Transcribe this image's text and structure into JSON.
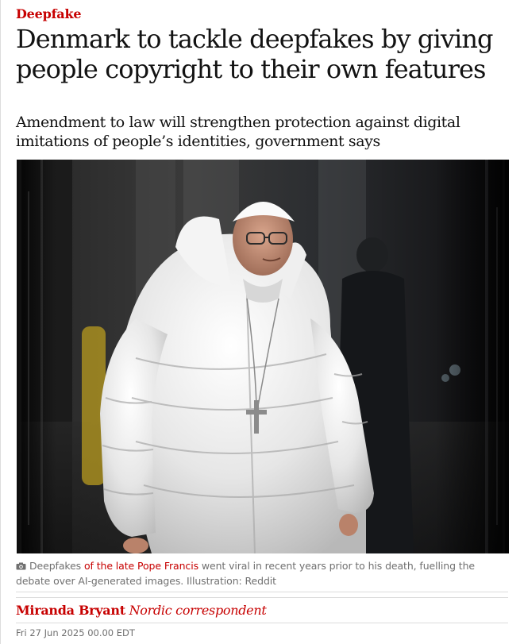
{
  "article": {
    "kicker": "Deepfake",
    "headline": "Denmark to tackle deepfakes by giving people copyright to their own features",
    "standfirst": "Amendment to law will strengthen protection against digital imitations of people’s identities, government says"
  },
  "caption": {
    "camera_icon": "camera-icon",
    "lead": "Deepfakes ",
    "link_text": "of the late Pope Francis",
    "rest": " went viral in recent years prior to his death, fuelling the debate over AI-generated images. Illustration: Reddit"
  },
  "byline": {
    "name": "Miranda Bryant",
    "role": "Nordic correspondent"
  },
  "dateline": "Fri 27 Jun 2025 00.00 EDT",
  "colors": {
    "accent_red": "#c70000",
    "text": "#121212",
    "muted": "#707070",
    "rule": "#dcdcdc"
  }
}
